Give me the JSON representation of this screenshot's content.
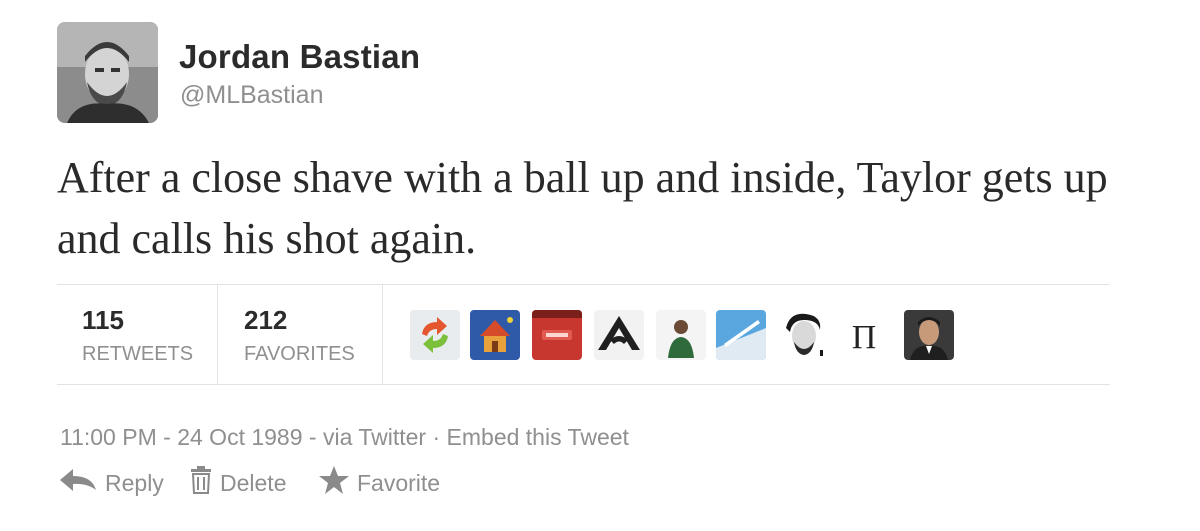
{
  "author": {
    "name": "Jordan Bastian",
    "handle": "@MLBastian"
  },
  "tweet": {
    "text": "After a close shave with a ball up and inside, Taylor gets up and calls his shot again."
  },
  "stats": {
    "retweets": {
      "count": "115",
      "label": "RETWEETS"
    },
    "favorites": {
      "count": "212",
      "label": "FAVORITES"
    }
  },
  "favoriters": [
    {
      "icon": "recycle-arrows-avatar"
    },
    {
      "icon": "house-avatar"
    },
    {
      "icon": "red-logo-avatar"
    },
    {
      "icon": "black-white-logo-avatar"
    },
    {
      "icon": "person-green-shirt-avatar"
    },
    {
      "icon": "blue-sky-avatar"
    },
    {
      "icon": "bw-portrait-avatar"
    },
    {
      "icon": "pi-symbol-avatar",
      "glyph": "Π"
    },
    {
      "icon": "man-portrait-avatar"
    }
  ],
  "meta": {
    "time": "11:00 PM",
    "sep1": " - ",
    "date": "24 Oct 1989",
    "sep2": " - ",
    "via": "via Twitter",
    "sep3": " · ",
    "embed": "Embed this Tweet"
  },
  "actions": {
    "reply": "Reply",
    "delete": "Delete",
    "favorite": "Favorite"
  },
  "colors": {
    "text_dark": "#2b2b2b",
    "text_muted": "#8f8f8f",
    "divider": "#e3e3e3"
  }
}
